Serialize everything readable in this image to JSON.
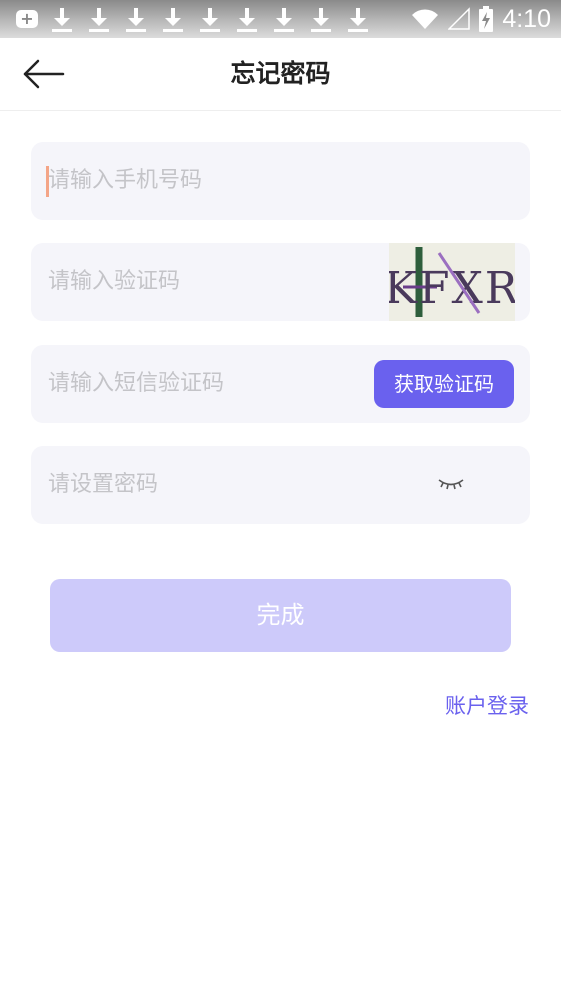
{
  "status_bar": {
    "time": "4:10",
    "icons": [
      "add-box-icon",
      "download-icon",
      "download-icon",
      "download-icon",
      "download-icon",
      "download-icon",
      "download-icon",
      "download-icon",
      "download-icon",
      "download-icon",
      "wifi-icon",
      "signal-icon",
      "battery-charging-icon"
    ]
  },
  "header": {
    "title": "忘记密码",
    "back_icon": "arrow-left-icon"
  },
  "form": {
    "phone_placeholder": "请输入手机号码",
    "captcha_placeholder": "请输入验证码",
    "captcha_image_text": "KFXR",
    "sms_placeholder": "请输入短信验证码",
    "sms_button_label": "获取验证码",
    "password_placeholder": "请设置密码",
    "password_toggle_icon": "eye-closed-icon"
  },
  "actions": {
    "done_label": "完成",
    "login_link": "账户登录"
  },
  "colors": {
    "accent": "#6a61ee",
    "accent_disabled": "#cdcafa",
    "field_bg": "#f5f5fa",
    "placeholder": "#c4c4c8",
    "cursor": "#f4a587"
  }
}
